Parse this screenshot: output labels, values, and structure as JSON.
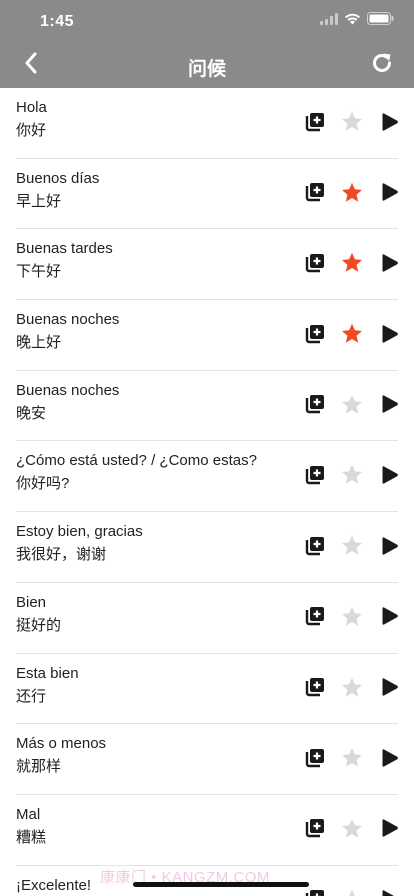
{
  "status_bar": {
    "time": "1:45",
    "icons": [
      "cellular-icon",
      "wifi-icon",
      "battery-icon"
    ]
  },
  "header": {
    "title": "问候",
    "back_icon": "chevron-left-icon",
    "refresh_icon": "refresh-icon",
    "background_color": "#8a8a8a"
  },
  "colors": {
    "star_active": "#f04a23",
    "star_inactive": "#d9d9d9",
    "icon_dark": "#1a1a1a"
  },
  "phrases": [
    {
      "phrase": "Hola",
      "translation": "你好",
      "favorite": false
    },
    {
      "phrase": "Buenos días",
      "translation": "早上好",
      "favorite": true
    },
    {
      "phrase": "Buenas tardes",
      "translation": "下午好",
      "favorite": true
    },
    {
      "phrase": "Buenas noches",
      "translation": "晚上好",
      "favorite": true
    },
    {
      "phrase": "Buenas noches",
      "translation": "晚安",
      "favorite": false
    },
    {
      "phrase": "¿Cómo está usted? / ¿Como estas?",
      "translation": "你好吗?",
      "favorite": false
    },
    {
      "phrase": "Estoy bien, gracias",
      "translation": "我很好，谢谢",
      "favorite": false
    },
    {
      "phrase": "Bien",
      "translation": "挺好的",
      "favorite": false
    },
    {
      "phrase": "Esta bien",
      "translation": "还行",
      "favorite": false
    },
    {
      "phrase": "Más o menos",
      "translation": "就那样",
      "favorite": false
    },
    {
      "phrase": "Mal",
      "translation": "糟糕",
      "favorite": false
    },
    {
      "phrase": "¡Excelente!",
      "translation": "",
      "favorite": false
    }
  ],
  "row_icons": {
    "copy": "add-to-list-icon",
    "star": "star-icon",
    "play": "play-icon"
  },
  "watermark": "康康门 • KANGZM.COM"
}
